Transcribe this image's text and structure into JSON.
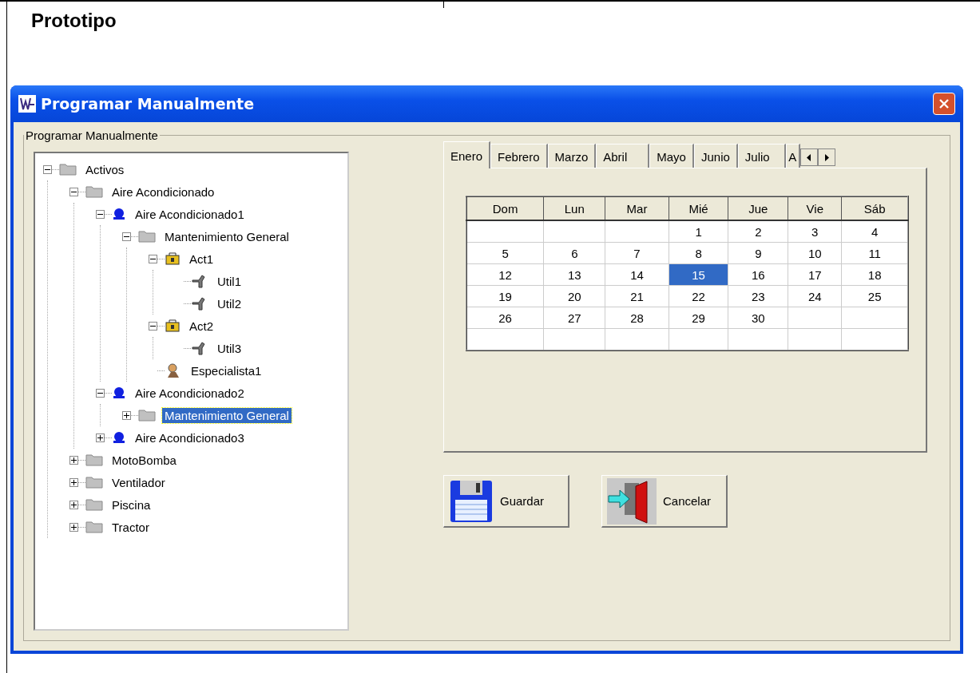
{
  "heading": "Prototipo",
  "window": {
    "title": "Programar Manualmente"
  },
  "group": {
    "label": "Programar Manualmente"
  },
  "tree": [
    {
      "label": "Activos",
      "kind": "folder",
      "expanded": true,
      "selected": false,
      "children": [
        {
          "label": "Aire Acondicionado",
          "kind": "folder",
          "expanded": true,
          "selected": false,
          "children": [
            {
              "label": "Aire Acondicionado1",
              "kind": "device",
              "expanded": true,
              "selected": false,
              "children": [
                {
                  "label": "Mantenimiento General",
                  "kind": "folder",
                  "expanded": true,
                  "selected": false,
                  "children": [
                    {
                      "label": "Act1",
                      "kind": "activity",
                      "expanded": true,
                      "selected": false,
                      "children": [
                        {
                          "label": "Util1",
                          "kind": "tool",
                          "selected": false
                        },
                        {
                          "label": "Util2",
                          "kind": "tool",
                          "selected": false
                        }
                      ]
                    },
                    {
                      "label": "Act2",
                      "kind": "activity",
                      "expanded": true,
                      "selected": false,
                      "children": [
                        {
                          "label": "Util3",
                          "kind": "tool",
                          "selected": false
                        }
                      ]
                    },
                    {
                      "label": "Especialista1",
                      "kind": "specialist",
                      "selected": false
                    }
                  ]
                }
              ]
            },
            {
              "label": "Aire Acondicionado2",
              "kind": "device",
              "expanded": true,
              "selected": false,
              "children": [
                {
                  "label": "Mantenimiento General",
                  "kind": "folder",
                  "expanded": false,
                  "selected": true
                }
              ]
            },
            {
              "label": "Aire Acondicionado3",
              "kind": "device",
              "expanded": false,
              "selected": false
            }
          ]
        },
        {
          "label": "MotoBomba",
          "kind": "folder",
          "expanded": false,
          "selected": false
        },
        {
          "label": "Ventilador",
          "kind": "folder",
          "expanded": false,
          "selected": false
        },
        {
          "label": "Piscina",
          "kind": "folder",
          "expanded": false,
          "selected": false
        },
        {
          "label": "Tractor",
          "kind": "folder",
          "expanded": false,
          "selected": false
        }
      ]
    }
  ],
  "tabs": [
    {
      "label": "Enero",
      "selected": true
    },
    {
      "label": "Febrero",
      "selected": false
    },
    {
      "label": "Marzo",
      "selected": false
    },
    {
      "label": "Abril",
      "selected": false
    },
    {
      "label": "Mayo",
      "selected": false
    },
    {
      "label": "Junio",
      "selected": false
    },
    {
      "label": "Julio",
      "selected": false
    },
    {
      "label": "A",
      "selected": false
    }
  ],
  "calendar": {
    "columns": [
      "Dom",
      "Lun",
      "Mar",
      "Mié",
      "Jue",
      "Vie",
      "Sáb"
    ],
    "weeks": [
      [
        {
          "kind": "blank"
        },
        {
          "kind": "blank"
        },
        {
          "kind": "blank"
        },
        {
          "kind": "day",
          "day": "1",
          "selected": false
        },
        {
          "kind": "day",
          "day": "2",
          "selected": false
        },
        {
          "kind": "day",
          "day": "3",
          "selected": false
        },
        {
          "kind": "day",
          "day": "4",
          "selected": false
        }
      ],
      [
        {
          "kind": "day",
          "day": "5",
          "selected": false
        },
        {
          "kind": "day",
          "day": "6",
          "selected": false
        },
        {
          "kind": "day",
          "day": "7",
          "selected": false
        },
        {
          "kind": "day",
          "day": "8",
          "selected": false
        },
        {
          "kind": "day",
          "day": "9",
          "selected": false
        },
        {
          "kind": "day",
          "day": "10",
          "selected": false
        },
        {
          "kind": "day",
          "day": "11",
          "selected": false
        }
      ],
      [
        {
          "kind": "day",
          "day": "12",
          "selected": false
        },
        {
          "kind": "day",
          "day": "13",
          "selected": false
        },
        {
          "kind": "day",
          "day": "14",
          "selected": false
        },
        {
          "kind": "day",
          "day": "15",
          "selected": true
        },
        {
          "kind": "day",
          "day": "16",
          "selected": false
        },
        {
          "kind": "day",
          "day": "17",
          "selected": false
        },
        {
          "kind": "day",
          "day": "18",
          "selected": false
        }
      ],
      [
        {
          "kind": "day",
          "day": "19",
          "selected": false
        },
        {
          "kind": "day",
          "day": "20",
          "selected": false
        },
        {
          "kind": "day",
          "day": "21",
          "selected": false
        },
        {
          "kind": "day",
          "day": "22",
          "selected": false
        },
        {
          "kind": "day",
          "day": "23",
          "selected": false
        },
        {
          "kind": "day",
          "day": "24",
          "selected": false
        },
        {
          "kind": "day",
          "day": "25",
          "selected": false
        }
      ],
      [
        {
          "kind": "day",
          "day": "26",
          "selected": false
        },
        {
          "kind": "day",
          "day": "27",
          "selected": false
        },
        {
          "kind": "day",
          "day": "28",
          "selected": false
        },
        {
          "kind": "day",
          "day": "29",
          "selected": false
        },
        {
          "kind": "day",
          "day": "30",
          "selected": false
        },
        {
          "kind": "blank"
        },
        {
          "kind": "blank"
        }
      ],
      [
        {
          "kind": "blank"
        },
        {
          "kind": "blank"
        },
        {
          "kind": "blank"
        },
        {
          "kind": "blank"
        },
        {
          "kind": "blank"
        },
        {
          "kind": "blank"
        },
        {
          "kind": "blank"
        }
      ]
    ]
  },
  "buttons": [
    {
      "label": "Guardar",
      "kind": "save"
    },
    {
      "label": "Cancelar",
      "kind": "cancel"
    }
  ]
}
